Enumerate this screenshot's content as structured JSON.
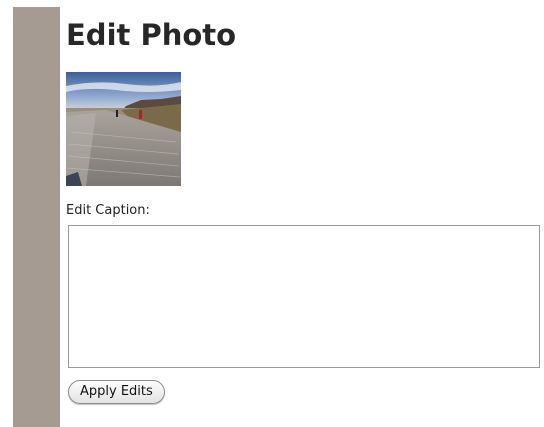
{
  "page": {
    "title": "Edit Photo"
  },
  "photo": {
    "description": "thumbnail photo"
  },
  "caption": {
    "label": "Edit Caption:",
    "value": ""
  },
  "actions": {
    "apply_label": "Apply Edits"
  },
  "colors": {
    "left_bar": "#a69b93",
    "title_text": "#272727"
  }
}
